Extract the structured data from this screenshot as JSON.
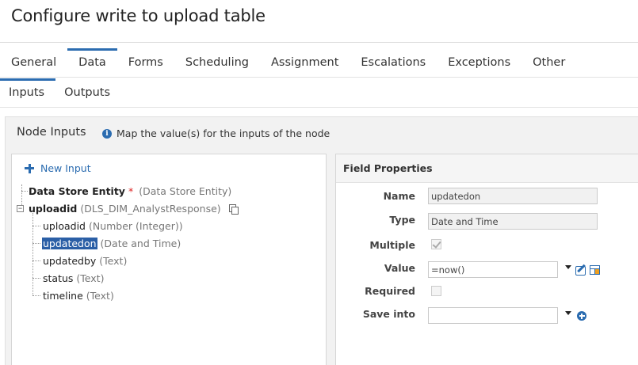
{
  "window": {
    "title": "Configure write to upload table"
  },
  "tabs": [
    {
      "label": "General"
    },
    {
      "label": "Data"
    },
    {
      "label": "Forms"
    },
    {
      "label": "Scheduling"
    },
    {
      "label": "Assignment"
    },
    {
      "label": "Escalations"
    },
    {
      "label": "Exceptions"
    },
    {
      "label": "Other"
    }
  ],
  "active_tab": "Data",
  "subtabs": [
    {
      "label": "Inputs"
    },
    {
      "label": "Outputs"
    }
  ],
  "active_subtab": "Inputs",
  "node_inputs": {
    "title": "Node Inputs",
    "info": "Map the value(s) for the inputs of the node",
    "new_input_label": "New Input",
    "tree": {
      "data_store_entity": {
        "name": "Data Store Entity",
        "required_mark": "*",
        "type": "(Data Store Entity)"
      },
      "uploadid_group": {
        "name": "uploadid",
        "type": "(DLS_DIM_AnalystResponse)",
        "expander": "−",
        "children": [
          {
            "name": "uploadid",
            "type": "(Number (Integer))"
          },
          {
            "name": "updatedon",
            "type": "(Date and Time)"
          },
          {
            "name": "updatedby",
            "type": "(Text)"
          },
          {
            "name": "status",
            "type": "(Text)"
          },
          {
            "name": "timeline",
            "type": "(Text)"
          }
        ]
      }
    },
    "selected_child": "updatedon"
  },
  "field_properties": {
    "title": "Field Properties",
    "name": {
      "label": "Name",
      "value": "updatedon"
    },
    "type": {
      "label": "Type",
      "value": "Date and Time"
    },
    "multiple": {
      "label": "Multiple",
      "checked": true
    },
    "value": {
      "label": "Value",
      "value": "=now()"
    },
    "required": {
      "label": "Required",
      "checked": false
    },
    "save_into": {
      "label": "Save into",
      "value": ""
    }
  },
  "colors": {
    "accent": "#2b6cb0",
    "selection": "#2b5fa6",
    "required": "#dd2222"
  }
}
